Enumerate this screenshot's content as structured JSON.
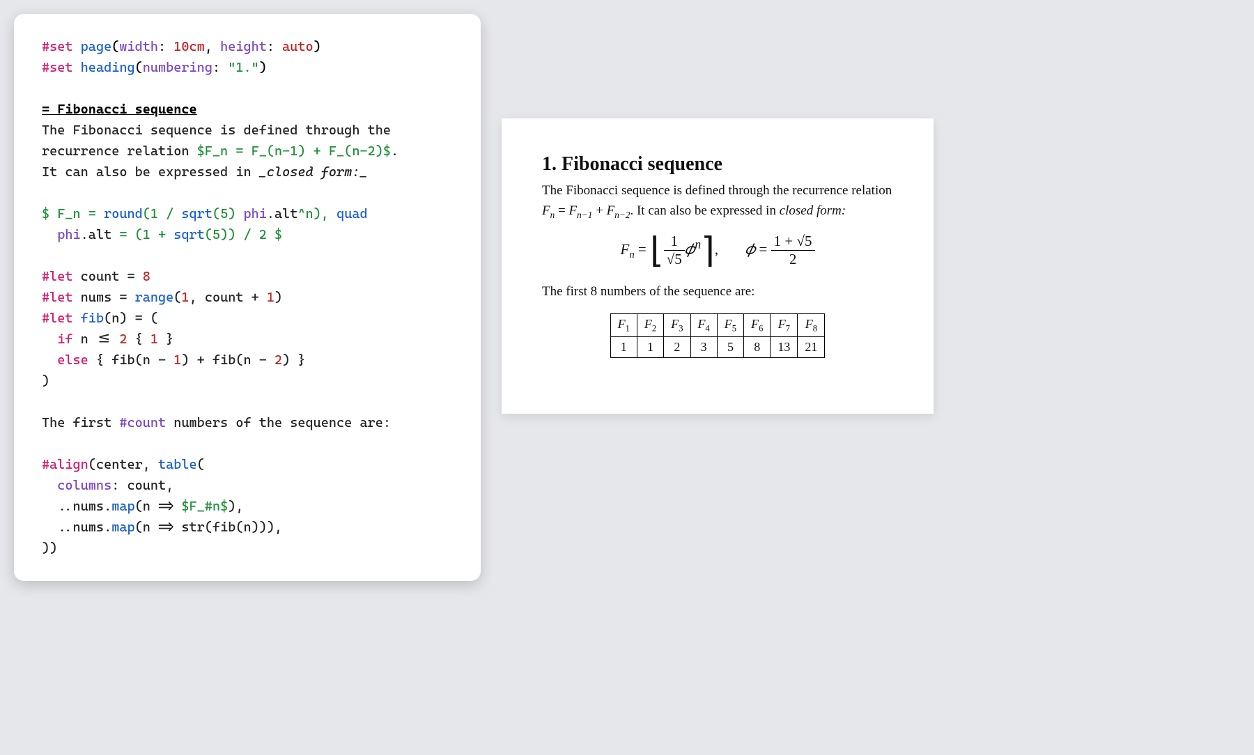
{
  "code": {
    "l1_set": "#set",
    "l1_page": "page",
    "l1_width": "width",
    "l1_widthv": "10cm",
    "l1_height": "height",
    "l1_heightv": "auto",
    "l2_set": "#set",
    "l2_heading": "heading",
    "l2_numbering": "numbering",
    "l2_numberingv": "\"1.\"",
    "l4_heading": "= Fibonacci sequence",
    "l5": "The Fibonacci sequence is defined through the",
    "l6a": "recurrence relation ",
    "l6m": "$F_n = F_(n-1) + F_(n-2)$",
    "l6b": ".",
    "l7a": "It can also be expressed in ",
    "l7emph": "_closed form:_",
    "l9a": "$ F_n = ",
    "l9_round": "round",
    "l9b": "(1 / ",
    "l9_sqrt": "sqrt",
    "l9c": "(5) ",
    "l9_phi": "phi",
    "l9_alt": ".alt",
    "l9d": "^n), ",
    "l9_quad": "quad",
    "l10_phi": "phi",
    "l10_alt": ".alt",
    "l10a": " = (1 + ",
    "l10_sqrt": "sqrt",
    "l10b": "(5)) / 2 $",
    "l12_let": "#let",
    "l12_var": "count",
    "l12_eq": " = ",
    "l12_val": "8",
    "l13_let": "#let",
    "l13_var": "nums",
    "l13_eq": " = ",
    "l13_range": "range",
    "l13a": "(",
    "l13_1": "1",
    "l13b": ", count + ",
    "l13_1b": "1",
    "l13c": ")",
    "l14_let": "#let",
    "l14_fib": "fib",
    "l14a": "(n) = (",
    "l15_if": "if",
    "l15a": " n <= ",
    "l15_2": "2",
    "l15b": " { ",
    "l15_1": "1",
    "l15c": " }",
    "l16_else": "else",
    "l16a": " { fib(n - ",
    "l16_1": "1",
    "l16b": ") + fib(n - ",
    "l16_2": "2",
    "l16c": ") }",
    "l17": ")",
    "l19a": "The first ",
    "l19_count": "#count",
    "l19b": " numbers of the sequence are:",
    "l21_align": "#align",
    "l21a": "(center, ",
    "l21_table": "table",
    "l21b": "(",
    "l22_columns": "columns",
    "l22a": ": count,",
    "l23a": "  ..nums.",
    "l23_map": "map",
    "l23b": "(n => ",
    "l23_m": "$F_#n$",
    "l23c": "),",
    "l24a": "  ..nums.",
    "l24_map": "map",
    "l24b": "(n => str(fib(n))),",
    "l25": "))"
  },
  "output": {
    "heading": "1. Fibonacci sequence",
    "para1a": "The Fibonacci sequence is defined through the recurrence relation ",
    "para1b": ". It can also be expressed in ",
    "para1emph": "closed form:",
    "F": "F",
    "n": "n",
    "nm1": "n−1",
    "nm2": "n−2",
    "eq": " = ",
    "plus": " + ",
    "one": "1",
    "sqrt5": "√5",
    "phi": "𝜙",
    "sup_n": "n",
    "comma": ",",
    "oneplus": "1 + √5",
    "two": "2",
    "para2a": "The first 8 numbers of the sequence are:",
    "headers": [
      "1",
      "2",
      "3",
      "4",
      "5",
      "6",
      "7",
      "8"
    ],
    "values": [
      "1",
      "1",
      "2",
      "3",
      "5",
      "8",
      "13",
      "21"
    ]
  }
}
